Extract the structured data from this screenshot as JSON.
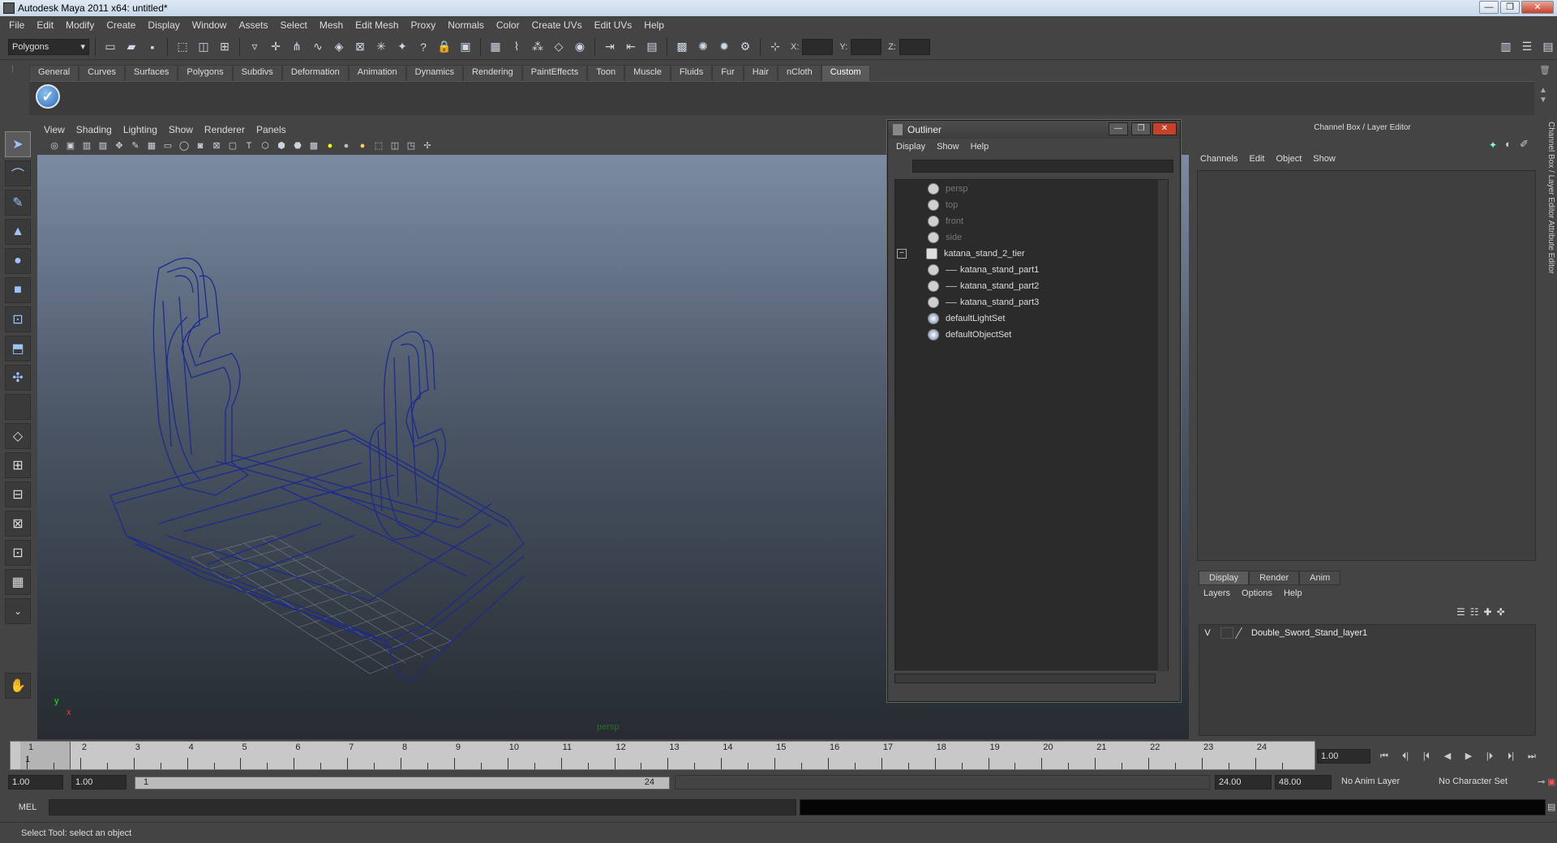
{
  "window": {
    "title": "Autodesk Maya 2011 x64: untitled*",
    "buttons": [
      "—",
      "❐",
      "✕"
    ]
  },
  "menubar": [
    "File",
    "Edit",
    "Modify",
    "Create",
    "Display",
    "Window",
    "Assets",
    "Select",
    "Mesh",
    "Edit Mesh",
    "Proxy",
    "Normals",
    "Color",
    "Create UVs",
    "Edit UVs",
    "Help"
  ],
  "statusline": {
    "menuset": "Polygons",
    "coord_x": "X:",
    "coord_y": "Y:",
    "coord_z": "Z:"
  },
  "shelf": {
    "tabs": [
      "General",
      "Curves",
      "Surfaces",
      "Polygons",
      "Subdivs",
      "Deformation",
      "Animation",
      "Dynamics",
      "Rendering",
      "PaintEffects",
      "Toon",
      "Muscle",
      "Fluids",
      "Fur",
      "Hair",
      "nCloth",
      "Custom"
    ],
    "active_tab": "Custom"
  },
  "viewport": {
    "menu": [
      "View",
      "Shading",
      "Lighting",
      "Show",
      "Renderer",
      "Panels"
    ],
    "camera_label": "persp",
    "axis_y": "y",
    "axis_x": "x"
  },
  "outliner": {
    "title": "Outliner",
    "menu": [
      "Display",
      "Show",
      "Help"
    ],
    "collapse_glyph": "−",
    "items": [
      {
        "label": "persp",
        "dim": true,
        "indent": 0
      },
      {
        "label": "top",
        "dim": true,
        "indent": 0
      },
      {
        "label": "front",
        "dim": true,
        "indent": 0
      },
      {
        "label": "side",
        "dim": true,
        "indent": 0
      },
      {
        "label": "katana_stand_2_tier",
        "dim": false,
        "indent": 0
      },
      {
        "label": "katana_stand_part1",
        "dim": false,
        "indent": 1
      },
      {
        "label": "katana_stand_part2",
        "dim": false,
        "indent": 1
      },
      {
        "label": "katana_stand_part3",
        "dim": false,
        "indent": 1
      },
      {
        "label": "defaultLightSet",
        "dim": false,
        "indent": 0
      },
      {
        "label": "defaultObjectSet",
        "dim": false,
        "indent": 0
      }
    ]
  },
  "channelbox": {
    "title": "Channel Box / Layer Editor",
    "menu": [
      "Channels",
      "Edit",
      "Object",
      "Show"
    ],
    "side_tabs": "Channel Box / Layer Editor   Attribute Editor"
  },
  "layers": {
    "tabs": [
      "Display",
      "Render",
      "Anim"
    ],
    "active_tab": "Display",
    "menu": [
      "Layers",
      "Options",
      "Help"
    ],
    "rows": [
      {
        "visible": "V",
        "name": "Double_Sword_Stand_layer1"
      }
    ]
  },
  "timeslider": {
    "ticks": [
      "1",
      "2",
      "3",
      "4",
      "5",
      "6",
      "7",
      "8",
      "9",
      "10",
      "11",
      "12",
      "13",
      "14",
      "15",
      "16",
      "17",
      "18",
      "19",
      "20",
      "21",
      "22",
      "23",
      "24"
    ],
    "current_marker": "1",
    "current_frame": "1.00",
    "playback_buttons": [
      "⏮",
      "⏴|",
      "|⏴",
      "◀",
      "▶",
      "|⏵",
      "⏵|",
      "⏭"
    ]
  },
  "range": {
    "anim_start": "1.00",
    "playback_start": "1.00",
    "range_low": "1",
    "range_high": "24",
    "playback_end": "24.00",
    "anim_end": "48.00",
    "anim_layer": "No Anim Layer",
    "character_set": "No Character Set"
  },
  "commandline": {
    "label": "MEL"
  },
  "helpline": {
    "text": "Select Tool: select an object"
  }
}
